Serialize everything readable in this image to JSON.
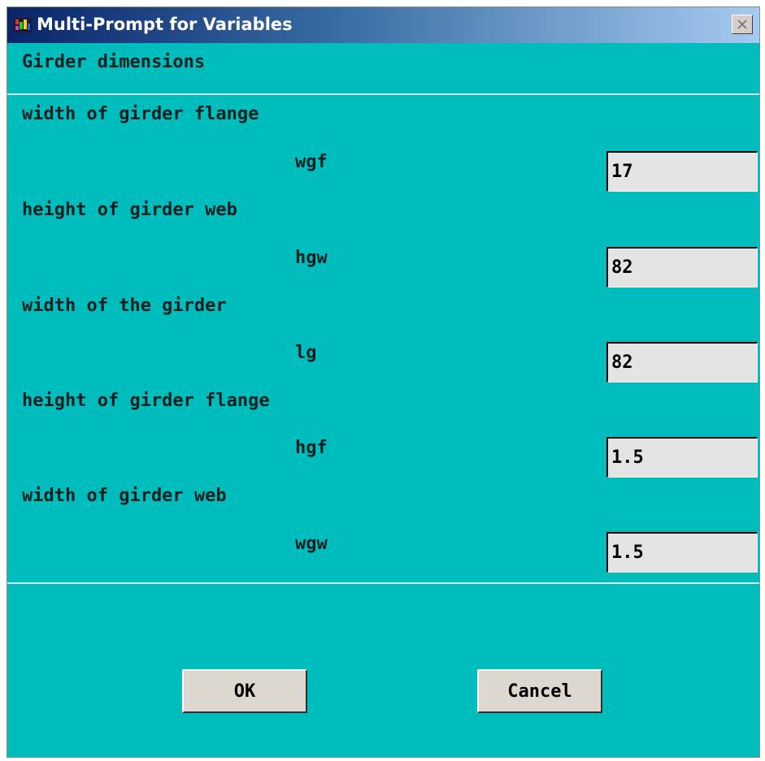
{
  "window": {
    "title": "Multi-Prompt for Variables",
    "close_symbol": "✕",
    "app_icon": "app-icon",
    "close_icon": "close-icon"
  },
  "header": {
    "label": "Girder dimensions"
  },
  "variables": [
    {
      "description": "width of girder flange",
      "name": "wgf",
      "value": "17"
    },
    {
      "description": "height of girder web",
      "name": "hgw",
      "value": "82"
    },
    {
      "description": "width of the girder",
      "name": "lg",
      "value": "82"
    },
    {
      "description": "height of girder flange",
      "name": "hgf",
      "value": "1.5"
    },
    {
      "description": "width of girder web",
      "name": "wgw",
      "value": "1.5"
    }
  ],
  "buttons": {
    "ok_label": "OK",
    "cancel_label": "Cancel"
  },
  "colors": {
    "dialog_background": "#00bdbd",
    "titlebar_start": "#0a246a",
    "titlebar_end": "#a6caf0",
    "field_background": "#e4e4e4",
    "button_face": "#dcd8d0"
  }
}
